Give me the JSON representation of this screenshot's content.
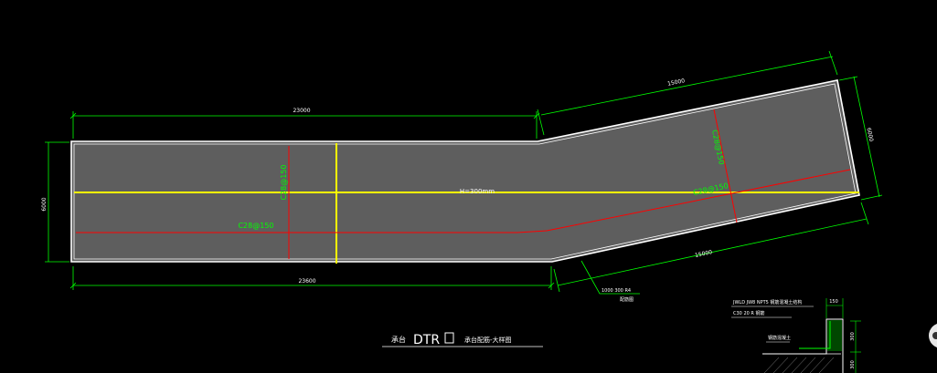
{
  "drawing": {
    "dims": {
      "top_left": "23000",
      "top_right": "15000",
      "bottom_left": "23600",
      "bottom_right": "15000",
      "left_height": "6000",
      "right_height": "6000"
    },
    "rebar": {
      "vertical_left": "C28@150",
      "horizontal_left": "C28@150",
      "vertical_right": "C28@150",
      "horizontal_right": "C28@150"
    },
    "thickness_label": "H=300mm",
    "title_main": "DTR",
    "title_prefix": "承台",
    "title_suffix": "承台配筋-大样图",
    "small_note_1": "1000  300  R4",
    "small_note_2": "配筋图",
    "detail": {
      "note_line_1": "JWLD  JW8  NPT5  钢筋混凝土结构",
      "note_line_2": "C30  20  R  钢筋",
      "label_top": "150",
      "label_side_1": "300",
      "label_side_2": "300",
      "block_label": "钢筋混凝土"
    },
    "colors": {
      "background": "#000000",
      "slab": "#5e5e5e",
      "outline": "#ffffff",
      "dimension": "#00ff00",
      "centerline": "#ffff00",
      "rebar": "#ff0000",
      "label": "#00ff00"
    }
  }
}
